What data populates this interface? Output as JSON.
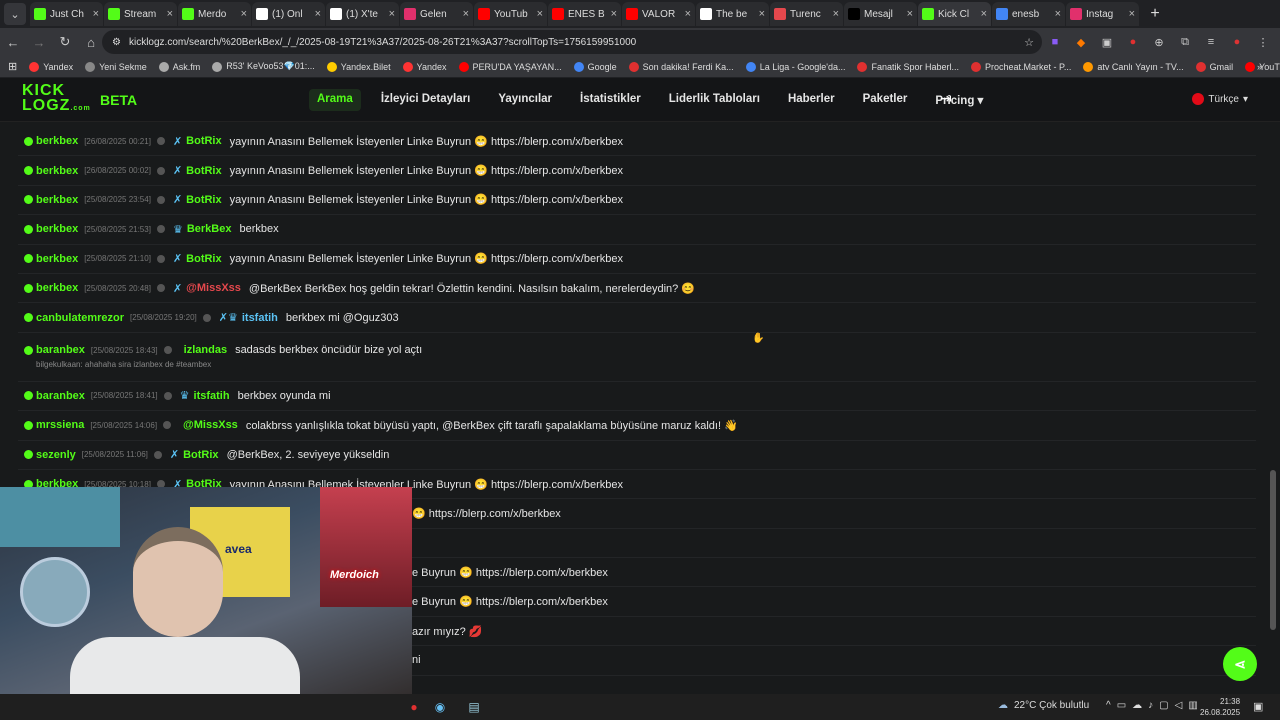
{
  "browser": {
    "tabs": [
      {
        "title": "Just Ch",
        "color": "#53fc18"
      },
      {
        "title": "Stream",
        "color": "#53fc18"
      },
      {
        "title": "Merdo",
        "color": "#53fc18"
      },
      {
        "title": "(1) Onl",
        "color": "#ffffff"
      },
      {
        "title": "(1) X'te",
        "color": "#ffffff"
      },
      {
        "title": "Gelen",
        "color": "#e1306c"
      },
      {
        "title": "YouTub",
        "color": "#ff0000"
      },
      {
        "title": "ENES B",
        "color": "#ff0000"
      },
      {
        "title": "VALOR",
        "color": "#ff0000"
      },
      {
        "title": "The be",
        "color": "#ffffff"
      },
      {
        "title": "Turenc",
        "color": "#e5484d"
      },
      {
        "title": "Mesajl",
        "color": "#000000"
      },
      {
        "title": "Kick Cl",
        "color": "#53fc18"
      },
      {
        "title": "enesb",
        "color": "#4285f4"
      },
      {
        "title": "Instag",
        "color": "#e1306c"
      }
    ],
    "active_tab_index": 12,
    "url": "kicklogz.com/search/%20BerkBex/_/_/2025-08-19T21%3A37/2025-08-26T21%3A37?scrollTopTs=1756159951000",
    "bookmarks": [
      {
        "label": "Yandex",
        "color": "#ff3333"
      },
      {
        "label": "Yeni Sekme",
        "color": "#888888"
      },
      {
        "label": "Ask.fm",
        "color": "#aaaaaa"
      },
      {
        "label": "R53' KeVoo53💎01:...",
        "color": "#aaaaaa"
      },
      {
        "label": "Yandex.Bilet",
        "color": "#ffcc00"
      },
      {
        "label": "Yandex",
        "color": "#ff3333"
      },
      {
        "label": "PERU'DA YAŞAYAN...",
        "color": "#ff0000"
      },
      {
        "label": "Google",
        "color": "#4285f4"
      },
      {
        "label": "Son dakika! Ferdi Ka...",
        "color": "#e03030"
      },
      {
        "label": "La Liga - Google'da...",
        "color": "#4285f4"
      },
      {
        "label": "Fanatik Spor Haberl...",
        "color": "#e03030"
      },
      {
        "label": "Procheat.Market - P...",
        "color": "#e03030"
      },
      {
        "label": "atv Canlı Yayın - TV...",
        "color": "#ff9900"
      },
      {
        "label": "Gmail",
        "color": "#e03030"
      },
      {
        "label": "YouTube",
        "color": "#ff0000"
      }
    ]
  },
  "site": {
    "logo_line1": "KICK",
    "logo_line2": "LOGZ",
    "logo_suffix": ".com",
    "beta": "BETA",
    "menu": [
      "Arama",
      "İzleyici Detayları",
      "Yayıncılar",
      "İstatistikler",
      "Liderlik Tabloları",
      "Haberler",
      "Paketler",
      "Pricing ▾"
    ],
    "language": "Türkçe",
    "accent": "#53fc18"
  },
  "rows": [
    {
      "user": "berkbex",
      "ts": "[26/08/2025 00:21]",
      "badge": "✗",
      "sender": "BotRix",
      "sender_color": "#53fc18",
      "msg": "yayının Anasını Bellemek İsteyenler Linke Buyrun 😁 https://blerp.com/x/berkbex"
    },
    {
      "user": "berkbex",
      "ts": "[26/08/2025 00:02]",
      "badge": "✗",
      "sender": "BotRix",
      "sender_color": "#53fc18",
      "msg": "yayının Anasını Bellemek İsteyenler Linke Buyrun 😁 https://blerp.com/x/berkbex"
    },
    {
      "user": "berkbex",
      "ts": "[25/08/2025 23:54]",
      "badge": "✗",
      "sender": "BotRix",
      "sender_color": "#53fc18",
      "msg": "yayının Anasını Bellemek İsteyenler Linke Buyrun 😁 https://blerp.com/x/berkbex"
    },
    {
      "user": "berkbex",
      "ts": "[25/08/2025 21:53]",
      "badge": "♛",
      "sender": "BerkBex",
      "sender_color": "#53fc18",
      "msg": "berkbex"
    },
    {
      "user": "berkbex",
      "ts": "[25/08/2025 21:10]",
      "badge": "✗",
      "sender": "BotRix",
      "sender_color": "#53fc18",
      "msg": "yayının Anasını Bellemek İsteyenler Linke Buyrun 😁 https://blerp.com/x/berkbex"
    },
    {
      "user": "berkbex",
      "ts": "[25/08/2025 20:48]",
      "badge": "✗",
      "sender": "@MissXss",
      "sender_color": "#e5484d",
      "msg": "@BerkBex BerkBex hoş geldin tekrar! Özlettin kendini. Nasılsın bakalım, nerelerdeydin? 😊"
    },
    {
      "user": "canbulatemrezor",
      "ts": "[25/08/2025 19:20]",
      "badge": "✗♛",
      "sender": "itsfatih",
      "sender_color": "#5bc3f5",
      "msg": "berkbex mi @Oguz303"
    },
    {
      "user": "baranbex",
      "ts": "[25/08/2025 18:43]",
      "badge": "",
      "sender": "izlandas",
      "sender_color": "#53fc18",
      "msg": "sadasds berkbex öncüdür bize yol açtı",
      "sub": "bilgekulkaan: ahahaha sira izlanbex de #teambex"
    },
    {
      "user": "baranbex",
      "ts": "[25/08/2025 18:41]",
      "badge": "♛",
      "sender": "itsfatih",
      "sender_color": "#53fc18",
      "msg": "berkbex oyunda mi"
    },
    {
      "user": "mrssiena",
      "ts": "[25/08/2025 14:06]",
      "badge": "",
      "sender": "@MissXss",
      "sender_color": "#53fc18",
      "msg": "colakbrss yanlışlıkla tokat büyüsü yaptı, @BerkBex çift taraflı şapalaklama büyüsüne maruz kaldı! 👋"
    },
    {
      "user": "sezenly",
      "ts": "[25/08/2025 11:06]",
      "badge": "✗",
      "sender": "BotRix",
      "sender_color": "#53fc18",
      "msg": "@BerkBex, 2. seviyeye yükseldin"
    },
    {
      "user": "berkbex",
      "ts": "[25/08/2025 10:18]",
      "badge": "✗",
      "sender": "BotRix",
      "sender_color": "#53fc18",
      "msg": "yayının Anasını Bellemek İsteyenler Linke Buyrun 😁 https://blerp.com/x/berkbex"
    },
    {
      "user": "",
      "ts": "",
      "badge": "",
      "sender": "",
      "sender_color": "#53fc18",
      "msg": "😁 https://blerp.com/x/berkbex",
      "offset": true
    },
    {
      "user": "",
      "ts": "",
      "badge": "",
      "sender": "",
      "sender_color": "#53fc18",
      "msg": "",
      "offset": true
    },
    {
      "user": "",
      "ts": "",
      "badge": "",
      "sender": "",
      "sender_color": "#53fc18",
      "msg": "e Buyrun 😁 https://blerp.com/x/berkbex",
      "offset": true
    },
    {
      "user": "",
      "ts": "",
      "badge": "",
      "sender": "",
      "sender_color": "#53fc18",
      "msg": "e Buyrun 😁 https://blerp.com/x/berkbex",
      "offset": true
    },
    {
      "user": "",
      "ts": "",
      "badge": "",
      "sender": "",
      "sender_color": "#53fc18",
      "msg": "azır mıyız? 💋",
      "offset": true
    },
    {
      "user": "",
      "ts": "",
      "badge": "",
      "sender": "",
      "sender_color": "#53fc18",
      "msg": "ni",
      "offset": true
    }
  ],
  "webcam": {
    "sign": "Merdoich",
    "jersey": "avea"
  },
  "taskbar": {
    "weather": "22°C  Çok bulutlu",
    "time": "21:38",
    "date": "26.08.2025"
  }
}
